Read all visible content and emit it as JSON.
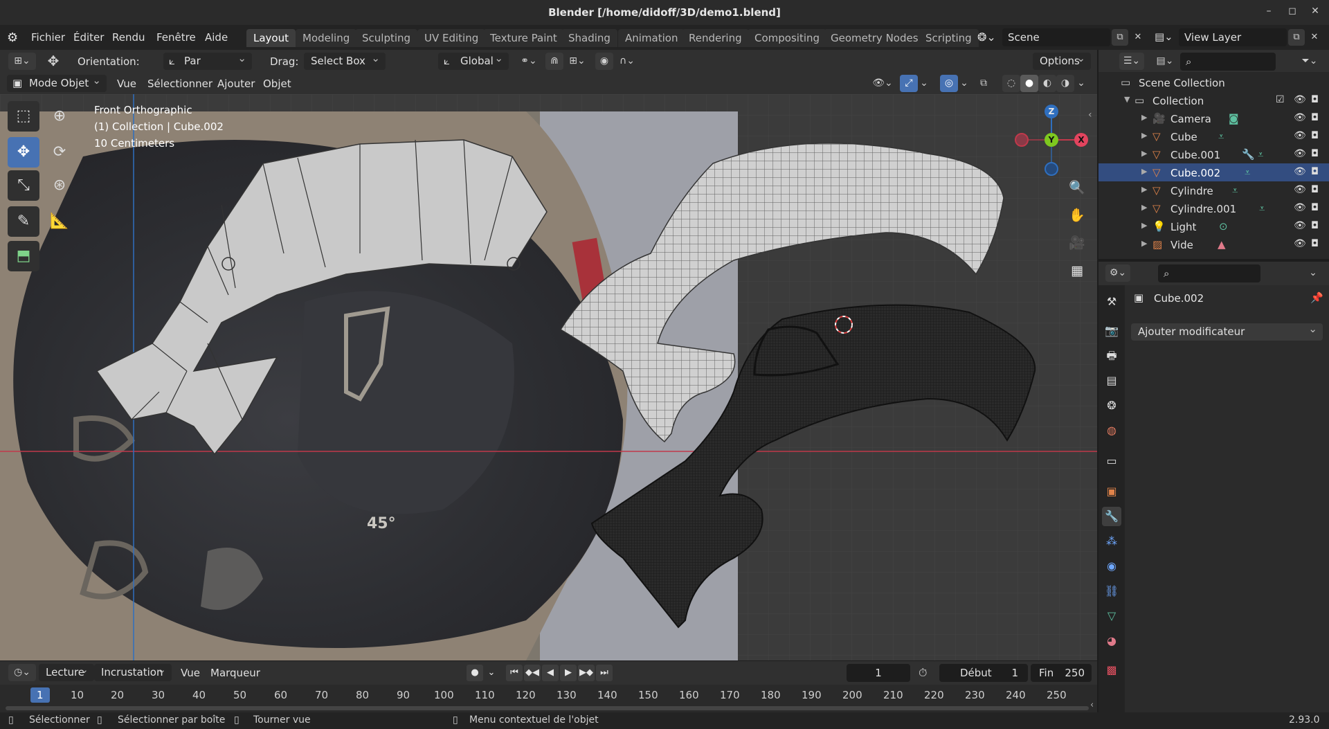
{
  "window": {
    "title": "Blender [/home/didoff/3D/demo1.blend]",
    "controls": [
      "–",
      "◻",
      "✕"
    ]
  },
  "menu": {
    "items": [
      "Fichier",
      "Éditer",
      "Rendu",
      "Fenêtre",
      "Aide"
    ]
  },
  "workspaces": {
    "tabs": [
      "Layout",
      "Modeling",
      "Sculpting",
      "UV Editing",
      "Texture Paint",
      "Shading",
      "Animation",
      "Rendering",
      "Compositing",
      "Geometry Nodes",
      "Scripting"
    ],
    "active": "Layout"
  },
  "scene": {
    "name": "Scene"
  },
  "view_layer": {
    "name": "View Layer"
  },
  "tool_header": {
    "orientation_label": "Orientation:",
    "orientation_value": "Par défaut",
    "drag_label": "Drag:",
    "drag_value": "Select Box",
    "transform_value": "Global",
    "options_label": "Options"
  },
  "viewport_header": {
    "mode": "Mode Objet",
    "menus": [
      "Vue",
      "Sélectionner",
      "Ajouter",
      "Objet"
    ]
  },
  "viewport": {
    "view_name": "Front Orthographic",
    "context": "(1) Collection | Cube.002",
    "scale": "10 Centimeters",
    "helmet_marking": "45°",
    "gizmo": {
      "z": "Z",
      "y": "Y",
      "x": "X"
    },
    "colors": {
      "background": "#3b3b3b",
      "x_axis": "#c0394b",
      "z_axis": "#2f6fbf"
    }
  },
  "outliner": {
    "root": "Scene Collection",
    "collection": "Collection",
    "objects": [
      {
        "name": "Camera",
        "icon": "camera-icon",
        "color": "#e0834a",
        "selected": false
      },
      {
        "name": "Cube",
        "icon": "mesh-icon",
        "color": "#e0834a",
        "selected": false
      },
      {
        "name": "Cube.001",
        "icon": "mesh-icon",
        "color": "#e0834a",
        "selected": false
      },
      {
        "name": "Cube.002",
        "icon": "mesh-icon",
        "color": "#e0834a",
        "selected": true
      },
      {
        "name": "Cylindre",
        "icon": "mesh-icon",
        "color": "#e0834a",
        "selected": false
      },
      {
        "name": "Cylindre.001",
        "icon": "mesh-icon",
        "color": "#e0834a",
        "selected": false
      },
      {
        "name": "Light",
        "icon": "light-icon",
        "color": "#e0834a",
        "selected": false
      },
      {
        "name": "Vide",
        "icon": "empty-image-icon",
        "color": "#e0834a",
        "selected": false
      }
    ]
  },
  "properties": {
    "object_name": "Cube.002",
    "add_modifier": "Ajouter modificateur"
  },
  "timeline": {
    "menus": [
      "Lecture",
      "Incrustation",
      "Vue",
      "Marqueur"
    ],
    "current_frame": "1",
    "start_label": "Début",
    "start_value": "1",
    "end_label": "Fin",
    "end_value": "250",
    "ticks": [
      "1",
      "10",
      "20",
      "30",
      "40",
      "50",
      "60",
      "70",
      "80",
      "90",
      "100",
      "110",
      "120",
      "130",
      "140",
      "150",
      "160",
      "170",
      "180",
      "190",
      "200",
      "210",
      "220",
      "230",
      "240",
      "250"
    ]
  },
  "statusbar": {
    "select": "Sélectionner",
    "box_select": "Sélectionner par boîte",
    "rotate_view": "Tourner vue",
    "context_menu": "Menu contextuel de l'objet",
    "version": "2.93.0"
  }
}
